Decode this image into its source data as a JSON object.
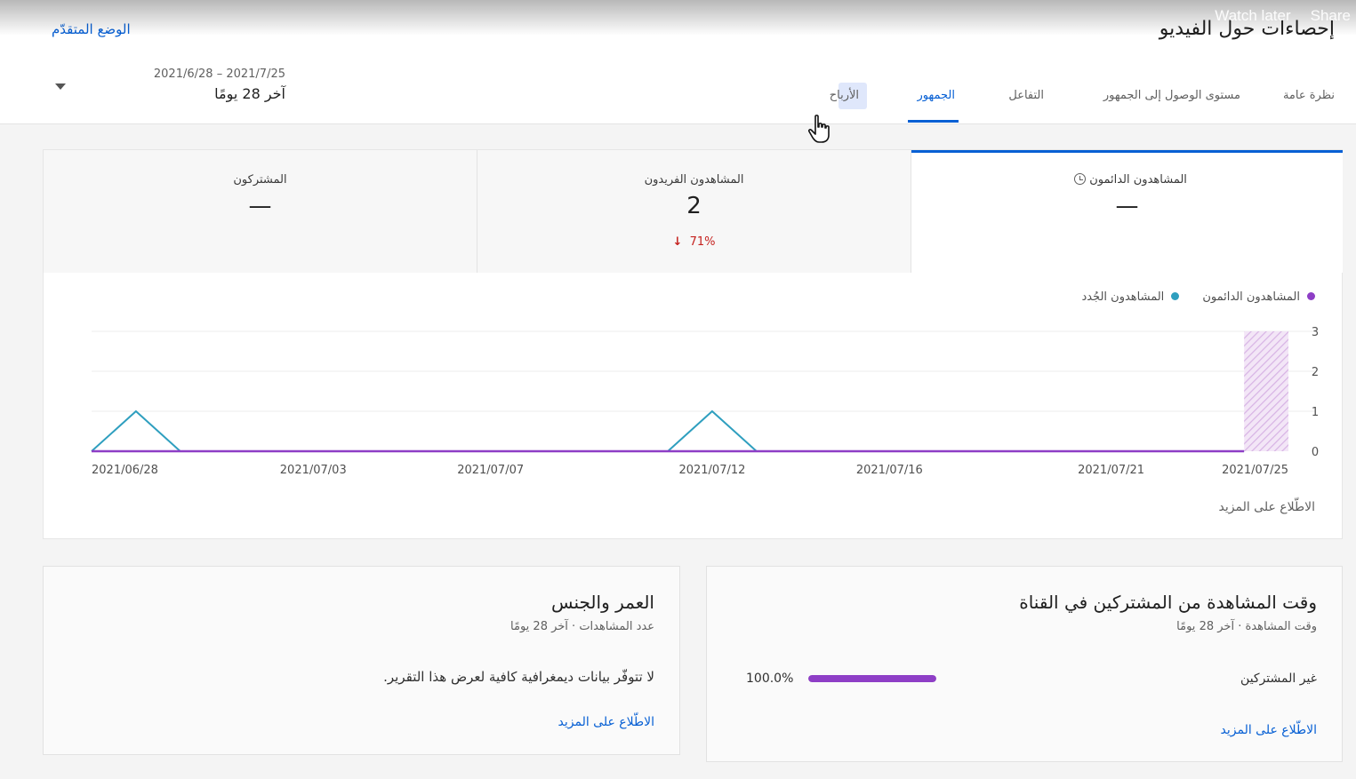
{
  "player": {
    "watch_later": "Watch later",
    "share": "Share"
  },
  "header": {
    "title": "إحصاءات حول الفيديو",
    "advanced_mode": "الوضع المتقدّم",
    "date_range": "2021/7/25 – 2021/6/28",
    "date_label": "آخر 28 يومًا"
  },
  "tabs": [
    {
      "label": "نظرة عامة",
      "active": false
    },
    {
      "label": "مستوى الوصول إلى الجمهور",
      "active": false
    },
    {
      "label": "التفاعل",
      "active": false
    },
    {
      "label": "الجمهور",
      "active": true
    },
    {
      "label": "الأرباح",
      "active": false
    }
  ],
  "metrics": [
    {
      "label": "المشاهدون الدائمون",
      "value": "—",
      "change": "",
      "selected": true,
      "icon": "clock-icon"
    },
    {
      "label": "المشاهدون الفريدون",
      "value": "2",
      "change": "71%",
      "change_direction": "down",
      "selected": false
    },
    {
      "label": "المشتركون",
      "value": "—",
      "change": "",
      "selected": false
    }
  ],
  "legend": {
    "returning": "المشاهدون الدائمون",
    "new": "المشاهدون الجُدد"
  },
  "colors": {
    "accent": "#065fd4",
    "returning": "#8e3ec6",
    "new": "#2f9fbf",
    "negative": "#c5221f"
  },
  "chart_data": {
    "type": "line",
    "x_labels": [
      "2021/06/28",
      "2021/07/03",
      "2021/07/07",
      "2021/07/12",
      "2021/07/16",
      "2021/07/21",
      "2021/07/25"
    ],
    "y_ticks": [
      0,
      1,
      2,
      3
    ],
    "ylim": [
      0,
      3
    ],
    "x_start": "2021/06/28",
    "x_end": "2021/07/25",
    "series": [
      {
        "name": "المشاهدون الدائمون",
        "x": [
          "2021/06/28",
          "2021/06/29",
          "2021/06/30",
          "2021/07/01",
          "2021/07/02",
          "2021/07/03",
          "2021/07/04",
          "2021/07/05",
          "2021/07/06",
          "2021/07/07",
          "2021/07/08",
          "2021/07/09",
          "2021/07/10",
          "2021/07/11",
          "2021/07/12",
          "2021/07/13",
          "2021/07/14",
          "2021/07/15",
          "2021/07/16",
          "2021/07/17",
          "2021/07/18",
          "2021/07/19",
          "2021/07/20",
          "2021/07/21",
          "2021/07/22",
          "2021/07/23",
          "2021/07/24"
        ],
        "values": [
          0,
          0,
          0,
          0,
          0,
          0,
          0,
          0,
          0,
          0,
          0,
          0,
          0,
          0,
          0,
          0,
          0,
          0,
          0,
          0,
          0,
          0,
          0,
          0,
          0,
          0,
          0
        ]
      },
      {
        "name": "المشاهدون الجُدد",
        "x": [
          "2021/06/28",
          "2021/06/29",
          "2021/06/30",
          "2021/07/01",
          "2021/07/02",
          "2021/07/03",
          "2021/07/04",
          "2021/07/05",
          "2021/07/06",
          "2021/07/07",
          "2021/07/08",
          "2021/07/09",
          "2021/07/10",
          "2021/07/11",
          "2021/07/12",
          "2021/07/13",
          "2021/07/14",
          "2021/07/15",
          "2021/07/16",
          "2021/07/17",
          "2021/07/18",
          "2021/07/19",
          "2021/07/20",
          "2021/07/21",
          "2021/07/22",
          "2021/07/23",
          "2021/07/24"
        ],
        "values": [
          0,
          1,
          0,
          0,
          0,
          0,
          0,
          0,
          0,
          0,
          0,
          0,
          0,
          0,
          1,
          0,
          0,
          0,
          0,
          0,
          0,
          0,
          0,
          0,
          0,
          0,
          0
        ]
      }
    ],
    "pending_period": [
      "2021/07/24",
      "2021/07/25"
    ]
  },
  "main_card": {
    "see_more": "الاطّلاع على المزيد"
  },
  "subscribers_card": {
    "title": "وقت المشاهدة من المشتركين في القناة",
    "subtitle": "وقت المشاهدة · آخر 28 يومًا",
    "row_label": "غير المشتركين",
    "row_value": "100.0%",
    "row_fraction": 1.0,
    "see_more": "الاطّلاع على المزيد"
  },
  "age_card": {
    "title": "العمر والجنس",
    "subtitle": "عدد المشاهدات · آخر 28 يومًا",
    "message": "لا تتوفّر بيانات ديمغرافية كافية لعرض هذا التقرير.",
    "see_more": "الاطّلاع على المزيد"
  }
}
